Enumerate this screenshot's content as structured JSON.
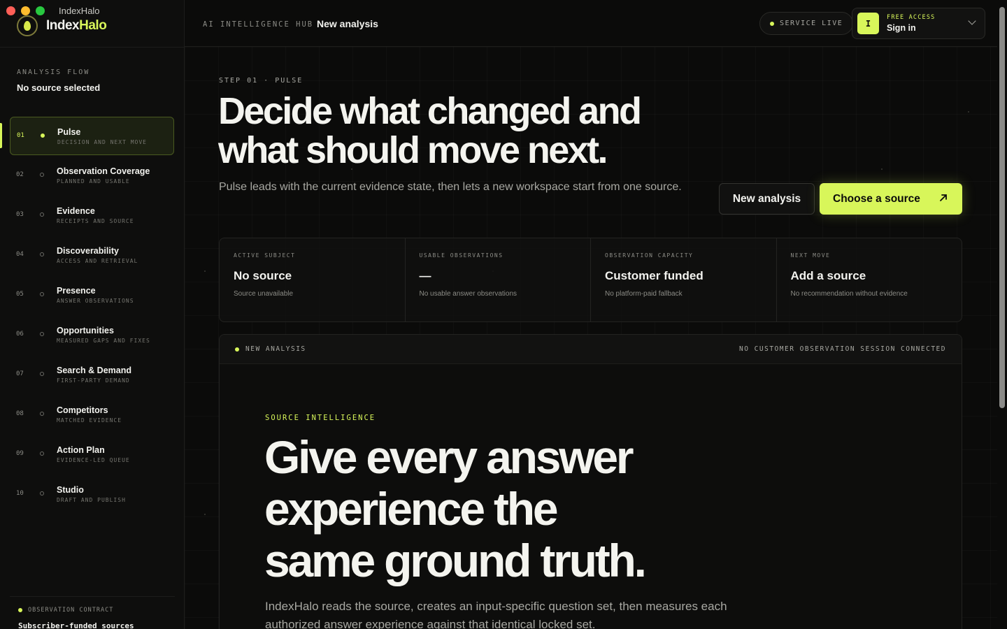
{
  "window": {
    "title": "IndexHalo"
  },
  "brand": {
    "name_part1": "Index",
    "name_part2": "Halo"
  },
  "sidebar": {
    "flow_label": "ANALYSIS FLOW",
    "flow_value": "No source selected",
    "items": [
      {
        "num": "01",
        "title": "Pulse",
        "sub": "DECISION AND NEXT MOVE",
        "active": true
      },
      {
        "num": "02",
        "title": "Observation Coverage",
        "sub": "PLANNED AND USABLE"
      },
      {
        "num": "03",
        "title": "Evidence",
        "sub": "RECEIPTS AND SOURCE"
      },
      {
        "num": "04",
        "title": "Discoverability",
        "sub": "ACCESS AND RETRIEVAL"
      },
      {
        "num": "05",
        "title": "Presence",
        "sub": "ANSWER OBSERVATIONS"
      },
      {
        "num": "06",
        "title": "Opportunities",
        "sub": "MEASURED GAPS AND FIXES"
      },
      {
        "num": "07",
        "title": "Search & Demand",
        "sub": "FIRST-PARTY DEMAND"
      },
      {
        "num": "08",
        "title": "Competitors",
        "sub": "MATCHED EVIDENCE"
      },
      {
        "num": "09",
        "title": "Action Plan",
        "sub": "EVIDENCE-LED QUEUE"
      },
      {
        "num": "10",
        "title": "Studio",
        "sub": "DRAFT AND PUBLISH"
      }
    ],
    "contract_label": "OBSERVATION CONTRACT",
    "contract_value": "Subscriber-funded sources"
  },
  "topbar": {
    "hub_label": "AI INTELLIGENCE HUB",
    "crumb": "New analysis",
    "service_status": "SERVICE LIVE",
    "access_label": "FREE ACCESS",
    "signin_label": "Sign in",
    "avatar_initial": "I"
  },
  "hero": {
    "step": "STEP 01 · PULSE",
    "title_line1": "Decide what changed and",
    "title_line2": "what should move next.",
    "subtitle": "Pulse leads with the current evidence state, then lets a new workspace start from one source.",
    "new_analysis_label": "New analysis",
    "choose_source_label": "Choose a source"
  },
  "stats": [
    {
      "label": "ACTIVE SUBJECT",
      "value": "No source",
      "note": "Source unavailable"
    },
    {
      "label": "USABLE OBSERVATIONS",
      "value": "—",
      "note": "No usable answer observations"
    },
    {
      "label": "OBSERVATION CAPACITY",
      "value": "Customer funded",
      "note": "No platform-paid fallback"
    },
    {
      "label": "NEXT MOVE",
      "value": "Add a source",
      "note": "No recommendation without evidence"
    }
  ],
  "panel": {
    "head_left": "NEW ANALYSIS",
    "head_right": "NO CUSTOMER OBSERVATION SESSION CONNECTED",
    "label": "SOURCE INTELLIGENCE",
    "title_line1": "Give every answer",
    "title_line2": "experience the",
    "title_line3": "same ground truth.",
    "subtitle": "IndexHalo reads the source, creates an input-specific question set, then measures each authorized answer experience against that identical locked set."
  },
  "colors": {
    "accent": "#d8f65a",
    "background": "#0b0b0a",
    "surface": "#111110",
    "border": "#232321"
  }
}
